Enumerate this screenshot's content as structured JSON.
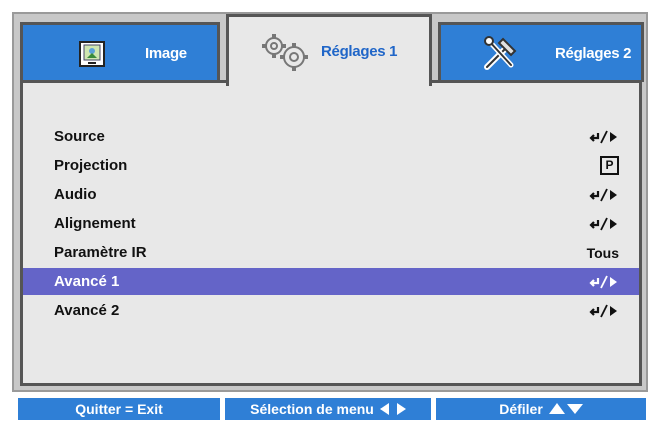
{
  "tabs": [
    {
      "label": "Image",
      "icon": "image-icon"
    },
    {
      "label": "Réglages 1",
      "icon": "gears-icon"
    },
    {
      "label": "Réglages 2",
      "icon": "tools-icon"
    }
  ],
  "menu": {
    "items": [
      {
        "label": "Source",
        "value": "",
        "icon": "enter-arrow-icon"
      },
      {
        "label": "Projection",
        "value": "P",
        "icon": "projection-icon"
      },
      {
        "label": "Audio",
        "value": "",
        "icon": "enter-arrow-icon"
      },
      {
        "label": "Alignement",
        "value": "",
        "icon": "enter-arrow-icon"
      },
      {
        "label": "Paramètre IR",
        "value": "Tous",
        "icon": ""
      },
      {
        "label": "Avancé 1",
        "value": "",
        "icon": "enter-arrow-icon"
      },
      {
        "label": "Avancé 2",
        "value": "",
        "icon": "enter-arrow-icon"
      }
    ],
    "selected_index": 5
  },
  "footer": {
    "exit_label": "Quitter = Exit",
    "select_label": "Sélection de menu",
    "scroll_label": "Défiler"
  },
  "colors": {
    "tab_blue": "#2f7fd6",
    "selected_row": "#6464c8",
    "panel_bg": "#e8e8e8"
  }
}
